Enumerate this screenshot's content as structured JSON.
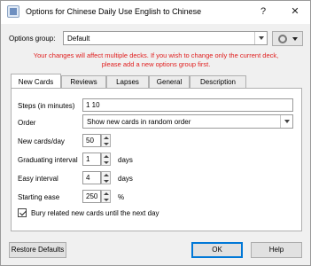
{
  "window": {
    "title": "Options for Chinese Daily Use English to Chinese",
    "help": "?",
    "close": "✕"
  },
  "options_group": {
    "label": "Options group:",
    "value": "Default"
  },
  "warning": {
    "line1": "Your changes will affect multiple decks. If you wish to change only the current deck,",
    "line2": "please add a new options group first."
  },
  "tabs": [
    "New Cards",
    "Reviews",
    "Lapses",
    "General",
    "Description"
  ],
  "new_cards": {
    "steps": {
      "label": "Steps (in minutes)",
      "value": "1 10"
    },
    "order": {
      "label": "Order",
      "value": "Show new cards in random order"
    },
    "new_per_day": {
      "label": "New cards/day",
      "value": "50"
    },
    "graduating": {
      "label": "Graduating interval",
      "value": "1",
      "unit": "days"
    },
    "easy": {
      "label": "Easy interval",
      "value": "4",
      "unit": "days"
    },
    "ease": {
      "label": "Starting ease",
      "value": "250",
      "unit": "%"
    },
    "bury": {
      "label": "Bury related new cards until the next day",
      "checked": true
    }
  },
  "buttons": {
    "restore": "Restore Defaults",
    "ok": "OK",
    "help": "Help"
  }
}
